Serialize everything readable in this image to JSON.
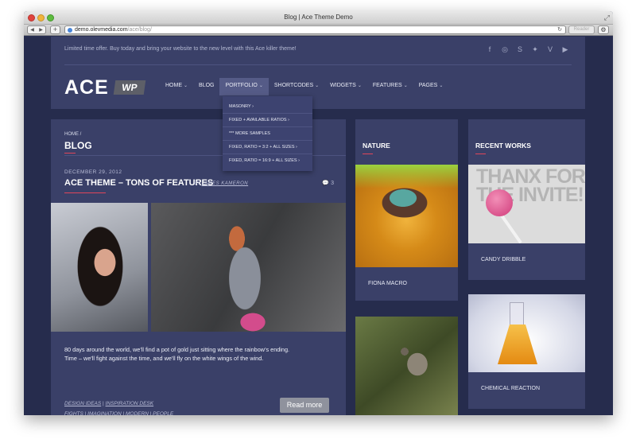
{
  "browser": {
    "window_title": "Blog | Ace Theme Demo",
    "url_host": "demo.olevmedia.com",
    "url_path": "/ace/blog/",
    "reader_label": "Reader",
    "nav_back": "◀",
    "nav_forward": "▶",
    "plus": "+",
    "reload": "↻",
    "gear": "⚙",
    "fullscreen": "⤢"
  },
  "header": {
    "promo": "Limited time offer. Buy today and bring your website to the new level with this Ace killer theme!",
    "logo": "ACE",
    "logo_badge": "WP",
    "social_icons": [
      {
        "name": "facebook-icon",
        "glyph": "f"
      },
      {
        "name": "dribbble-icon",
        "glyph": "◎"
      },
      {
        "name": "skype-icon",
        "glyph": "S"
      },
      {
        "name": "twitter-icon",
        "glyph": "✦"
      },
      {
        "name": "vimeo-icon",
        "glyph": "V"
      },
      {
        "name": "youtube-icon",
        "glyph": "▶"
      }
    ]
  },
  "nav": [
    {
      "label": "HOME",
      "has_caret": true,
      "active": false
    },
    {
      "label": "BLOG",
      "has_caret": false,
      "active": false
    },
    {
      "label": "PORTFOLIO",
      "has_caret": true,
      "active": true
    },
    {
      "label": "SHORTCODES",
      "has_caret": true,
      "active": false
    },
    {
      "label": "WIDGETS",
      "has_caret": true,
      "active": false
    },
    {
      "label": "FEATURES",
      "has_caret": true,
      "active": false
    },
    {
      "label": "PAGES",
      "has_caret": true,
      "active": false
    }
  ],
  "portfolio_dropdown": [
    "MASONRY ›",
    "FIXED + AVAILABLE RATIOS ›",
    "*** MORE SAMPLES",
    "FIXED, RATIO = 3:2 + ALL SIZES ›",
    "FIXED, RATIO = 16:9 + ALL SIZES ›"
  ],
  "main": {
    "breadcrumb": "HOME /",
    "page_title": "BLOG",
    "post": {
      "date": "DECEMBER 29, 2012",
      "title": "ACE THEME – TONS OF FEATURES",
      "by_label": "BY",
      "author": "JAMES KAMERON",
      "comments": "3",
      "excerpt": "80 days around the world, we'll find a pot of gold just sitting where the rainbow's ending. Time – we'll fight against the time, and we'll fly on the white wings of the wind.",
      "categories": [
        "DESIGN IDEAS",
        "INSPIRATION DESK"
      ],
      "tags": [
        "FIGHTS",
        "IMAGINATION",
        "MODERN",
        "PEOPLE"
      ],
      "read_more": "Read more"
    }
  },
  "nature_widget": {
    "title": "NATURE",
    "caption": "FIONA MACRO"
  },
  "recent_works": {
    "title": "RECENT WORKS",
    "image1_text": "THANX FOR THE INVITE!",
    "item1": "CANDY DRIBBLE",
    "item2": "CHEMICAL REACTION"
  }
}
